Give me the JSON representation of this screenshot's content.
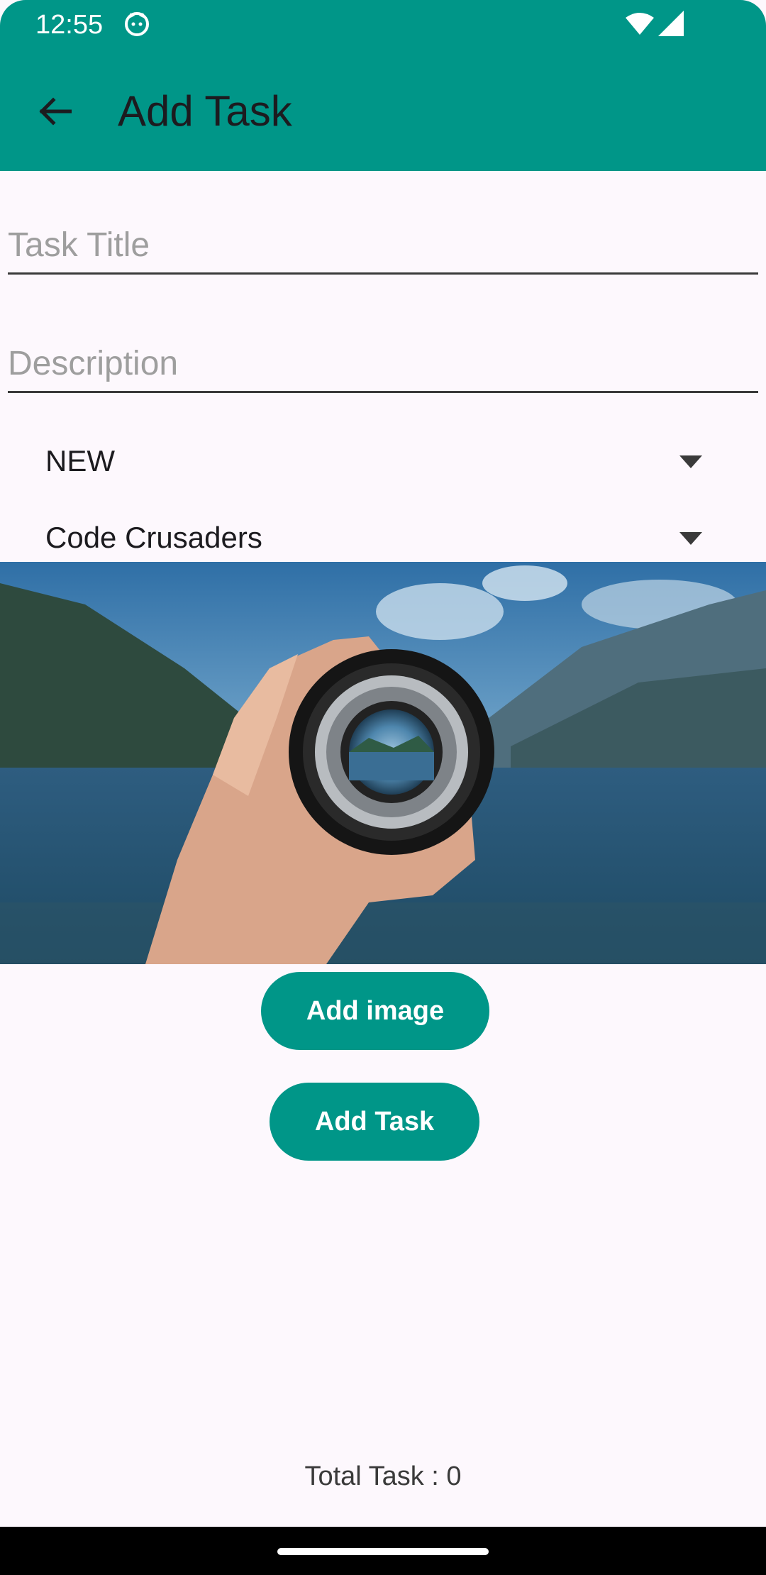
{
  "status_bar": {
    "time": "12:55"
  },
  "app_bar": {
    "title": "Add Task"
  },
  "form": {
    "title_placeholder": "Task Title",
    "title_value": "",
    "description_placeholder": "Description",
    "description_value": "",
    "status_spinner": "NEW",
    "team_spinner": "Code Crusaders"
  },
  "buttons": {
    "add_image": "Add image",
    "add_task": "Add Task"
  },
  "footer": {
    "total_tasks": "Total Task : 0"
  },
  "colors": {
    "accent": "#009688",
    "background": "#FDF8FD"
  },
  "icons": [
    "back-arrow-icon",
    "cat-icon",
    "wifi-icon",
    "signal-icon",
    "dropdown-arrow-icon"
  ]
}
